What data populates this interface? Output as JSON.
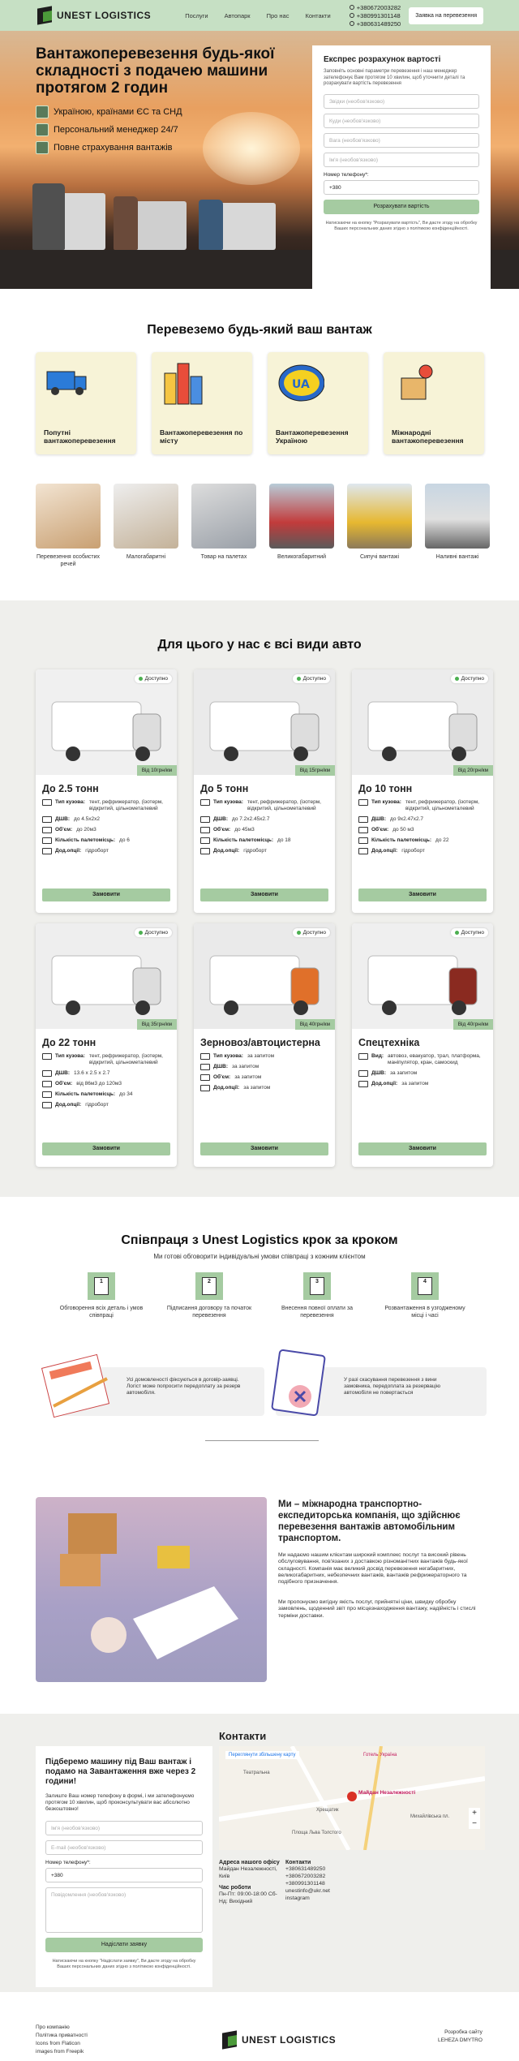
{
  "header": {
    "logo": "UNEST LOGISTICS",
    "nav": [
      "Послуги",
      "Автопарк",
      "Про нас",
      "Контакти"
    ],
    "phones": [
      "+380672003282",
      "+380991301148",
      "+380631489250"
    ],
    "call_button": "Заявка на перевезення"
  },
  "hero": {
    "title": "Вантажоперевезення будь-якої складності з подачею машини протягом 2 годин",
    "features": [
      "Україною, країнами ЄС та СНД",
      "Персональний менеджер 24/7",
      "Повне страхування вантажів"
    ]
  },
  "calc_form": {
    "title": "Експрес розрахунок вартості",
    "desc": "Заповніть основні параметри перевезення і наш менеджер зателефонує Вам протягом 10 хвилин, щоб уточнити деталі та розрахувати вартість перевезення",
    "fields": [
      "Звідки (необов'язково)",
      "Куди (необов'язково)",
      "Вага (необов'язково)",
      "Ім'я (необов'язково)"
    ],
    "phone_label": "Номер телефону*:",
    "phone_value": "+380",
    "button": "Розрахувати вартість",
    "fine": "Натискаючи на кнопку \"Розрахувати вартість\", Ви даєте згоду на обробку Ваших персональних даних згідно з політикою конфіденційності."
  },
  "cargo": {
    "title": "Перевеземо будь-який ваш вантаж",
    "cards": [
      "Попутні вантажоперевезення",
      "Вантажоперевезення по місту",
      "Вантажоперевезення Україною",
      "Міжнародні вантажоперевезення"
    ],
    "small": [
      "Перевезення особистих речей",
      "Малогабаритні",
      "Товар на палетах",
      "Великогабаритний",
      "Сипучі вантажі",
      "Наливні вантажі"
    ]
  },
  "fleet": {
    "title": "Для цього у нас є всі види авто",
    "available": "Доступно",
    "order": "Замовити",
    "vehicles": [
      {
        "name": "До 2.5 тонн",
        "price": "Від 10грн/км",
        "specs": [
          [
            "Тип кузова:",
            "тент, рефрижератор, (ізотерм, відкритий, цільнометалевий"
          ],
          [
            "ДШВ:",
            "до 4.5х2х2"
          ],
          [
            "Об'єм:",
            "до 20м3"
          ],
          [
            "Кількість палетомісць:",
            "до 6"
          ],
          [
            "Дод.опції:",
            "гідроборт"
          ]
        ]
      },
      {
        "name": "До 5 тонн",
        "price": "Від 15грн/км",
        "specs": [
          [
            "Тип кузова:",
            "тент, рефрижератор, (ізотерм, відкритий, цільнометалевий"
          ],
          [
            "ДШВ:",
            "до 7.2х2.45х2.7"
          ],
          [
            "Об'єм:",
            "до 45м3"
          ],
          [
            "Кількість палетомісць:",
            "до 18"
          ],
          [
            "Дод.опції:",
            "гідроборт"
          ]
        ]
      },
      {
        "name": "До 10 тонн",
        "price": "Від 20грн/км",
        "specs": [
          [
            "Тип кузова:",
            "тент, рефрижератор, (ізотерм, відкритий, цільнометалевий"
          ],
          [
            "ДШВ:",
            "до 9х2.47х2.7"
          ],
          [
            "Об'єм:",
            "до 50 м3"
          ],
          [
            "Кількість палетомісць:",
            "до 22"
          ],
          [
            "Дод.опції:",
            "гідроборт"
          ]
        ]
      },
      {
        "name": "До 22 тонн",
        "price": "Від 35грн/км",
        "specs": [
          [
            "Тип кузова:",
            "тент, рефрижератор, (ізотерм, відкритий, цільнометалевий"
          ],
          [
            "ДШВ:",
            "13.6 х 2.5 х 2.7"
          ],
          [
            "Об'єм:",
            "від 86м3 до 120м3"
          ],
          [
            "Кількість палетомісць:",
            "до 34"
          ],
          [
            "Дод.опції:",
            "гідроборт"
          ]
        ]
      },
      {
        "name": "Зерновоз/автоцистерна",
        "price": "Від 40грн/км",
        "specs": [
          [
            "Тип кузова:",
            "за запитом"
          ],
          [
            "ДШВ:",
            "за запитом"
          ],
          [
            "Об'єм:",
            "за запитом"
          ],
          [
            "Дод.опції:",
            "за запитом"
          ]
        ]
      },
      {
        "name": "Спецтехніка",
        "price": "Від 40грн/км",
        "specs": [
          [
            "Вид:",
            "автовоз, евакуатор, трал, платформа, маніпулятор, кран, самоскид"
          ],
          [
            "ДШВ:",
            "за запитом"
          ],
          [
            "Дод.опції:",
            "за запитом"
          ]
        ]
      }
    ]
  },
  "steps": {
    "title": "Співпраця з Unest Logistics крок за кроком",
    "subtitle": "Ми готові обговорити індивідуальні умови співпраці з кожним клієнтом",
    "items": [
      "Обговорення всіх деталь і умов співпраці",
      "Підписання договору та початок перевезення",
      "Внесення повної оплати за перевезення",
      "Розвантаження в узгодженому місці і часі"
    ],
    "notes": [
      "Усі домовленості фіксуються в договір-заявці. Логіст може попросити передоплату за резерв автомобіля.",
      "У разі скасування перевезення з вини замовника, передоплата за резервацію автомобіля не повертається"
    ]
  },
  "about": {
    "title": "Ми – міжнародна транспортно-експедиторська компанія, що здійснює перевезення вантажів автомобільним транспортом.",
    "p1": "Ми надаємо нашим клієнтам широкий комплекс послуг та високий рівень обслуговування, пов'язаних з доставкою різноманітних вантажів будь-якої складності. Компанія має великий досвід перевезення негабаритних, великогабаритних, небезпечних вантажів, вантажів рефрижераторного та подібного призначення.",
    "p2": "Ми пропонуємо вигідну якість послуг, прийнятні ціни, швидку обробку замовлень, щоденний звіт про місцезнаходження вантажу, надійність і стислі терміни доставки."
  },
  "contacts": {
    "form_title": "Підберемо машину під Ваш вантаж і подамо на Завантаження вже через 2 години!",
    "form_desc": "Залиште Ваш номер телефону в формі, і ми зателефонуємо протягом 10 хвилин, щоб проконсультувати вас абсолютно безкоштовно!",
    "fields": [
      "Ім'я (необов'язково)",
      "E-mail (необов'язково)"
    ],
    "phone_label": "Номер телефону*:",
    "phone_value": "+380",
    "message": "Повідомлення (необов'язково)",
    "button": "Надіслати заявку",
    "fine": "Натискаючи на кнопку \"Надіслати заявку\", Ви даєте згоду на обробку Ваших персональних даних згідно з політикою конфіденційності.",
    "title": "Контакти",
    "map_link": "Переглянути збільшену карту",
    "map_labels": [
      "Готель Україна",
      "Майдан Незалежності",
      "Хрещатик",
      "Площа Льва Толстого",
      "Театральна",
      "Михайлівська пл."
    ],
    "office_label": "Адреса нашого офісу",
    "office": "Майдан Незалежності, Київ",
    "hours_label": "Час роботи",
    "hours": "Пн-Пт: 09:00-18:00 Сб-Нд: Вихідний",
    "contacts_label": "Контакти",
    "contact_list": [
      "+380631489250",
      "+380672003282",
      "+380991301148",
      "unestinfo@ukr.net",
      "instagram"
    ]
  },
  "footer": {
    "left": [
      "Про компанію",
      "Політика приватності",
      "Icons from Flaticon",
      "images from Freepik"
    ],
    "right_label": "Розробка сайту",
    "right_name": "LEHEZA DMYTRO",
    "logo": "UNEST LOGISTICS"
  }
}
